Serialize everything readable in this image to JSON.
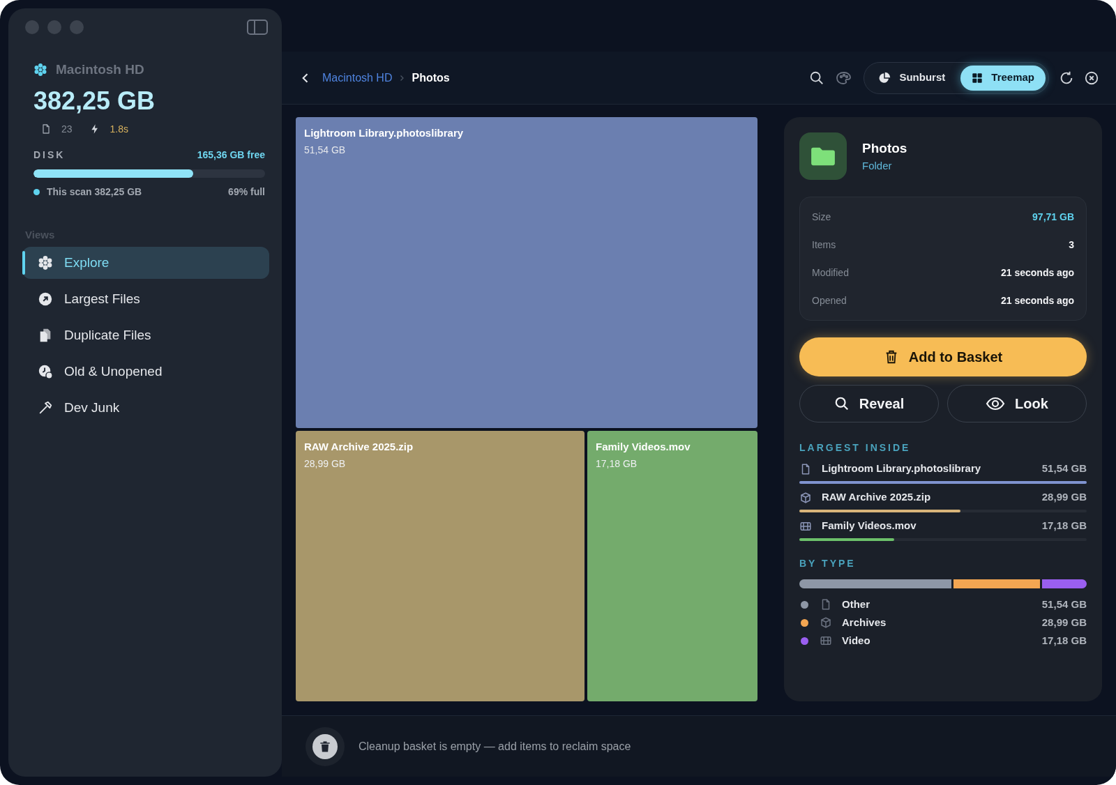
{
  "sidebar": {
    "volume": "Macintosh HD",
    "total": "382,25 GB",
    "file_count": "23",
    "scan_time": "1.8s",
    "disk": {
      "label": "DISK",
      "free": "165,36 GB free",
      "level": 0.69,
      "scan_note": "This scan 382,25 GB",
      "percent": "69% full"
    },
    "views_heading": "Views",
    "items": [
      {
        "label": "Explore",
        "kind": "explore",
        "selected": true
      },
      {
        "label": "Largest Files",
        "kind": "largest",
        "selected": false
      },
      {
        "label": "Duplicate Files",
        "kind": "duplicate",
        "selected": false
      },
      {
        "label": "Old & Unopened",
        "kind": "old",
        "selected": false
      },
      {
        "label": "Dev Junk",
        "kind": "dev",
        "selected": false
      }
    ]
  },
  "toolbar": {
    "breadcrumb": [
      {
        "label": "Macintosh HD",
        "current": false
      },
      {
        "label": "Photos",
        "current": true
      }
    ],
    "modes": [
      {
        "label": "Sunburst",
        "kind": "sunburst",
        "selected": false
      },
      {
        "label": "Treemap",
        "kind": "treemap",
        "selected": true
      }
    ]
  },
  "treemap": [
    {
      "name": "Lightroom Library.photoslibrary",
      "size": "51,54 GB",
      "color": "#6b7fb0"
    },
    {
      "name": "RAW Archive 2025.zip",
      "size": "28,99 GB",
      "color": "#a8976a"
    },
    {
      "name": "Family Videos.mov",
      "size": "17,18 GB",
      "color": "#74ab6c"
    }
  ],
  "details": {
    "name": "Photos",
    "type": "Folder",
    "properties": [
      {
        "label": "Size",
        "value": "97,71 GB",
        "kind": "accent"
      },
      {
        "label": "Items",
        "value": "3",
        "kind": "plain"
      },
      {
        "label": "Modified",
        "value": "21 seconds ago",
        "kind": "plain"
      },
      {
        "label": "Opened",
        "value": "21 seconds ago",
        "kind": "plain"
      }
    ],
    "primary_button": "Add to Basket",
    "buttons": [
      {
        "label": "Reveal",
        "kind": "search"
      },
      {
        "label": "Look",
        "kind": "eye"
      }
    ],
    "largest_heading": "LARGEST INSIDE",
    "largest": [
      {
        "name": "Lightroom Library.photoslibrary",
        "size": "51,54 GB",
        "kind": "file",
        "color": "#7f93cf",
        "level": 1
      },
      {
        "name": "RAW Archive 2025.zip",
        "size": "28,99 GB",
        "kind": "archive",
        "color": "#d9b57a",
        "level": 0.56
      },
      {
        "name": "Family Videos.mov",
        "size": "17,18 GB",
        "kind": "video",
        "color": "#6cc06a",
        "level": 0.33
      }
    ],
    "type_heading": "BY TYPE",
    "types": [
      {
        "label": "Other",
        "size": "51,54 GB",
        "kind": "file",
        "color": "#8e97a6"
      },
      {
        "label": "Archives",
        "size": "28,99 GB",
        "kind": "archive",
        "color": "#f3a652"
      },
      {
        "label": "Video",
        "size": "17,18 GB",
        "kind": "video",
        "color": "#9a5ff0"
      }
    ]
  },
  "status_bar": {
    "message": "Cleanup basket is empty — add items to reclaim space"
  }
}
